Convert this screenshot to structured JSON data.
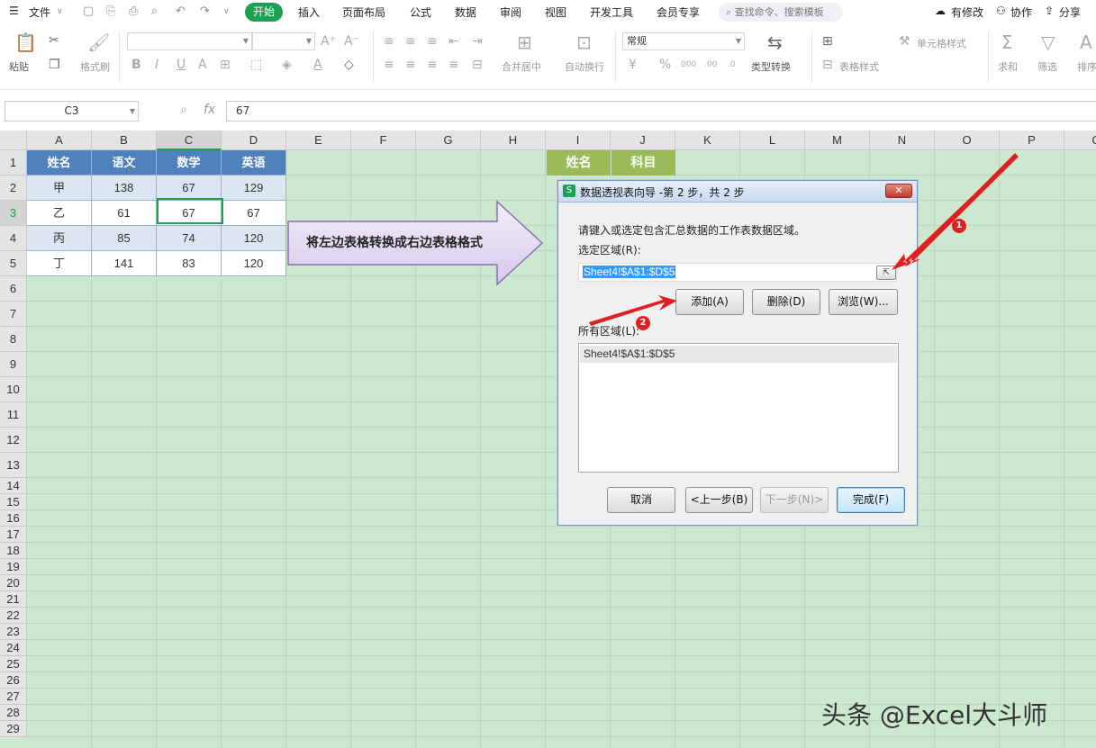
{
  "menubar": {
    "file": "文件",
    "tabs": [
      "开始",
      "插入",
      "页面布局",
      "公式",
      "数据",
      "审阅",
      "视图",
      "开发工具",
      "会员专享"
    ],
    "search_placeholder": "查找命令、搜索模板",
    "right": [
      "有修改",
      "协作",
      "分享"
    ]
  },
  "ribbon": {
    "paste": "粘贴",
    "cut_icon": "scissors-icon",
    "format_painter": "格式刷",
    "number_format": "常规",
    "merge": "合并居中",
    "wrap": "自动换行",
    "type_convert": "类型转换",
    "table_style": "表格样式",
    "cell_style": "单元格样式",
    "sum": "求和",
    "filter": "筛选",
    "sort": "排序"
  },
  "formula_bar": {
    "name_box": "C3",
    "fx": "fx",
    "value": "67"
  },
  "grid": {
    "columns": [
      "A",
      "B",
      "C",
      "D",
      "E",
      "F",
      "G",
      "H",
      "I",
      "J",
      "K",
      "L",
      "M",
      "N",
      "O",
      "P",
      "Q"
    ],
    "rows": [
      "1",
      "2",
      "3",
      "4",
      "5",
      "6",
      "7",
      "8",
      "9",
      "10",
      "11",
      "12",
      "13",
      "14",
      "15",
      "16",
      "17",
      "18",
      "19",
      "20",
      "21",
      "22",
      "23",
      "24",
      "25",
      "26",
      "27",
      "28",
      "29"
    ],
    "selected_col": "C",
    "selected_row": "3",
    "table_header": [
      "姓名",
      "语文",
      "数学",
      "英语"
    ],
    "table_rows": [
      [
        "甲",
        "138",
        "67",
        "129"
      ],
      [
        "乙",
        "61",
        "67",
        "67"
      ],
      [
        "丙",
        "85",
        "74",
        "120"
      ],
      [
        "丁",
        "141",
        "83",
        "120"
      ]
    ],
    "target_header": [
      "姓名",
      "科目"
    ]
  },
  "callout": {
    "text": "将左边表格转换成右边表格格式"
  },
  "dialog": {
    "title": "数据透视表向导 -第 2 步，共 2 步",
    "instruction": "请键入或选定包含汇总数据的工作表数据区域。",
    "select_label": "选定区域(R):",
    "range_value": "Sheet4!$A$1:$D$5",
    "add": "添加(A)",
    "delete": "删除(D)",
    "browse": "浏览(W)...",
    "all_label": "所有区域(L):",
    "all_items": [
      "Sheet4!$A$1:$D$5"
    ],
    "cancel": "取消",
    "prev": "<上一步(B)",
    "next": "下一步(N)>",
    "finish": "完成(F)"
  },
  "annotations": {
    "badge1": "1",
    "badge2": "2",
    "arrow_color": "#e02020"
  },
  "watermark": "头条 @Excel大斗师",
  "colors": {
    "accent": "#1f9e55",
    "grid_bg": "#cce8cf",
    "table_header": "#4f81bd",
    "target_header": "#9bbb59"
  }
}
